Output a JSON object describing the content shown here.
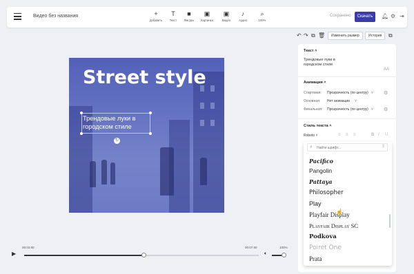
{
  "topbar": {
    "title": "Видео без названия",
    "tools": [
      {
        "icon": "plus-icon",
        "glyph": "+",
        "label": "Добавить"
      },
      {
        "icon": "text-icon",
        "glyph": "T",
        "label": "Текст"
      },
      {
        "icon": "filter-icon",
        "glyph": "■",
        "label": "Фигуры"
      },
      {
        "icon": "image-icon",
        "glyph": "▣",
        "label": "Картинка"
      },
      {
        "icon": "video-icon",
        "glyph": "▣",
        "label": "Видео"
      },
      {
        "icon": "music-icon",
        "glyph": "♪",
        "label": "Аудио"
      },
      {
        "icon": "zoom-icon",
        "glyph": "⌕",
        "label": "100%"
      }
    ],
    "saved": "Сохранено",
    "download": "Скачать"
  },
  "canvas": {
    "title": "Street style",
    "subtitle": "Трендовые луки в городском стиле"
  },
  "timeline": {
    "time_current": "00:03.80",
    "time_total": "00:07.50",
    "zoom": "100%",
    "progress": 0.51
  },
  "panel": {
    "resize_btn": "Изменить размер",
    "history_btn": "История",
    "text_section": "Текст",
    "text_value": "Трендовые луки в городском стиле",
    "aa": "AA",
    "anim_section": "Анимация",
    "anim_rows": [
      {
        "label": "Стартовая:",
        "value": "Прозрачность (по центру)"
      },
      {
        "label": "Основная:",
        "value": "Нет анимации"
      },
      {
        "label": "Финальная:",
        "value": "Прозрачность (по центру)"
      }
    ],
    "style_section": "Стиль текста",
    "font": "Roboto",
    "font_search_placeholder": "Найти шрифт...",
    "fonts": [
      "Pacifico",
      "Pangolin",
      "Pattaya",
      "Philosopher",
      "Play",
      "Playfair Display",
      "Playfair Display SC",
      "Podkova",
      "Poiret One",
      "Prata"
    ]
  }
}
